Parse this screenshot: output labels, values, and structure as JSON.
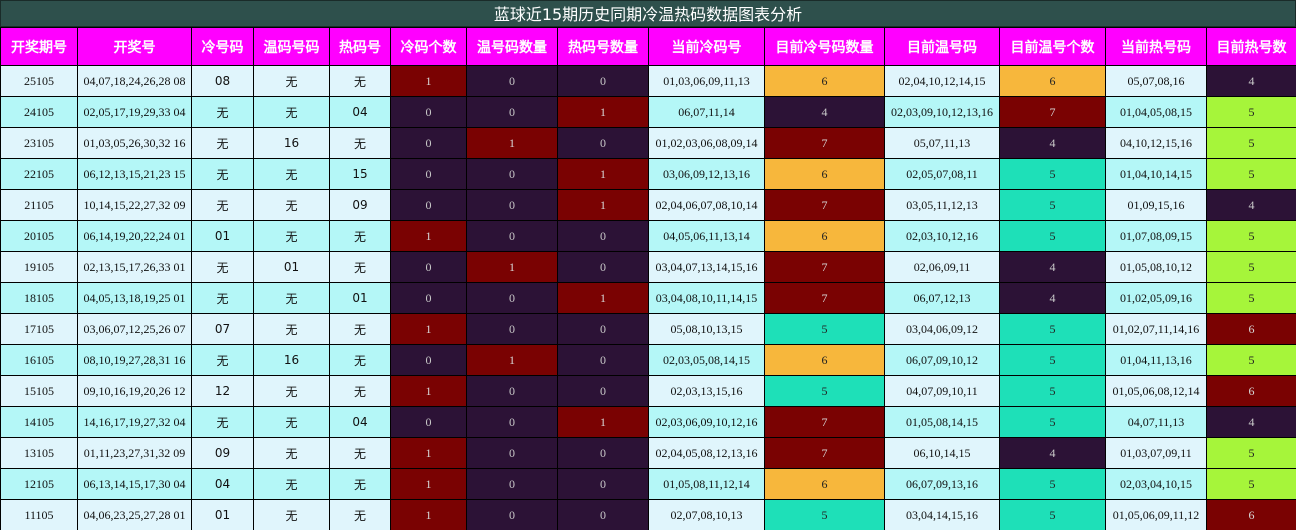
{
  "title": "蓝球近15期历史同期冷温热码数据图表分析",
  "colors": {
    "header_bg": "#ff00ff",
    "title_bg": "#2e504c",
    "count_dark": "#2c1236",
    "count_red": "#7a0202",
    "count_orange": "#f7b73c",
    "count_teal": "#1ee0b8",
    "count_green": "#a6f53a"
  },
  "headers": [
    "开奖期号",
    "开奖号",
    "冷号码",
    "温码号码",
    "热码号",
    "冷码个数",
    "温号码数量",
    "热码号数量",
    "当前冷码号",
    "目前冷号码数量",
    "目前温号码",
    "目前温号个数",
    "当前热号码",
    "目前热号数"
  ],
  "rows": [
    {
      "issue": "25105",
      "numbers": "04,07,18,24,26,28 08",
      "cold": "08",
      "warm": "无",
      "hot": "无",
      "cold_count": "1",
      "warm_count": "0",
      "hot_count": "0",
      "cur_cold": "01,03,06,09,11,13",
      "cur_cold_count": "6",
      "cur_warm": "02,04,10,12,14,15",
      "cur_warm_count": "6",
      "cur_hot": "05,07,08,16",
      "cur_hot_count": "4"
    },
    {
      "issue": "24105",
      "numbers": "02,05,17,19,29,33 04",
      "cold": "无",
      "warm": "无",
      "hot": "04",
      "cold_count": "0",
      "warm_count": "0",
      "hot_count": "1",
      "cur_cold": "06,07,11,14",
      "cur_cold_count": "4",
      "cur_warm": "02,03,09,10,12,13,16",
      "cur_warm_count": "7",
      "cur_hot": "01,04,05,08,15",
      "cur_hot_count": "5"
    },
    {
      "issue": "23105",
      "numbers": "01,03,05,26,30,32 16",
      "cold": "无",
      "warm": "16",
      "hot": "无",
      "cold_count": "0",
      "warm_count": "1",
      "hot_count": "0",
      "cur_cold": "01,02,03,06,08,09,14",
      "cur_cold_count": "7",
      "cur_warm": "05,07,11,13",
      "cur_warm_count": "4",
      "cur_hot": "04,10,12,15,16",
      "cur_hot_count": "5"
    },
    {
      "issue": "22105",
      "numbers": "06,12,13,15,21,23 15",
      "cold": "无",
      "warm": "无",
      "hot": "15",
      "cold_count": "0",
      "warm_count": "0",
      "hot_count": "1",
      "cur_cold": "03,06,09,12,13,16",
      "cur_cold_count": "6",
      "cur_warm": "02,05,07,08,11",
      "cur_warm_count": "5",
      "cur_hot": "01,04,10,14,15",
      "cur_hot_count": "5"
    },
    {
      "issue": "21105",
      "numbers": "10,14,15,22,27,32 09",
      "cold": "无",
      "warm": "无",
      "hot": "09",
      "cold_count": "0",
      "warm_count": "0",
      "hot_count": "1",
      "cur_cold": "02,04,06,07,08,10,14",
      "cur_cold_count": "7",
      "cur_warm": "03,05,11,12,13",
      "cur_warm_count": "5",
      "cur_hot": "01,09,15,16",
      "cur_hot_count": "4"
    },
    {
      "issue": "20105",
      "numbers": "06,14,19,20,22,24 01",
      "cold": "01",
      "warm": "无",
      "hot": "无",
      "cold_count": "1",
      "warm_count": "0",
      "hot_count": "0",
      "cur_cold": "04,05,06,11,13,14",
      "cur_cold_count": "6",
      "cur_warm": "02,03,10,12,16",
      "cur_warm_count": "5",
      "cur_hot": "01,07,08,09,15",
      "cur_hot_count": "5"
    },
    {
      "issue": "19105",
      "numbers": "02,13,15,17,26,33 01",
      "cold": "无",
      "warm": "01",
      "hot": "无",
      "cold_count": "0",
      "warm_count": "1",
      "hot_count": "0",
      "cur_cold": "03,04,07,13,14,15,16",
      "cur_cold_count": "7",
      "cur_warm": "02,06,09,11",
      "cur_warm_count": "4",
      "cur_hot": "01,05,08,10,12",
      "cur_hot_count": "5"
    },
    {
      "issue": "18105",
      "numbers": "04,05,13,18,19,25 01",
      "cold": "无",
      "warm": "无",
      "hot": "01",
      "cold_count": "0",
      "warm_count": "0",
      "hot_count": "1",
      "cur_cold": "03,04,08,10,11,14,15",
      "cur_cold_count": "7",
      "cur_warm": "06,07,12,13",
      "cur_warm_count": "4",
      "cur_hot": "01,02,05,09,16",
      "cur_hot_count": "5"
    },
    {
      "issue": "17105",
      "numbers": "03,06,07,12,25,26 07",
      "cold": "07",
      "warm": "无",
      "hot": "无",
      "cold_count": "1",
      "warm_count": "0",
      "hot_count": "0",
      "cur_cold": "05,08,10,13,15",
      "cur_cold_count": "5",
      "cur_warm": "03,04,06,09,12",
      "cur_warm_count": "5",
      "cur_hot": "01,02,07,11,14,16",
      "cur_hot_count": "6"
    },
    {
      "issue": "16105",
      "numbers": "08,10,19,27,28,31 16",
      "cold": "无",
      "warm": "16",
      "hot": "无",
      "cold_count": "0",
      "warm_count": "1",
      "hot_count": "0",
      "cur_cold": "02,03,05,08,14,15",
      "cur_cold_count": "6",
      "cur_warm": "06,07,09,10,12",
      "cur_warm_count": "5",
      "cur_hot": "01,04,11,13,16",
      "cur_hot_count": "5"
    },
    {
      "issue": "15105",
      "numbers": "09,10,16,19,20,26 12",
      "cold": "12",
      "warm": "无",
      "hot": "无",
      "cold_count": "1",
      "warm_count": "0",
      "hot_count": "0",
      "cur_cold": "02,03,13,15,16",
      "cur_cold_count": "5",
      "cur_warm": "04,07,09,10,11",
      "cur_warm_count": "5",
      "cur_hot": "01,05,06,08,12,14",
      "cur_hot_count": "6"
    },
    {
      "issue": "14105",
      "numbers": "14,16,17,19,27,32 04",
      "cold": "无",
      "warm": "无",
      "hot": "04",
      "cold_count": "0",
      "warm_count": "0",
      "hot_count": "1",
      "cur_cold": "02,03,06,09,10,12,16",
      "cur_cold_count": "7",
      "cur_warm": "01,05,08,14,15",
      "cur_warm_count": "5",
      "cur_hot": "04,07,11,13",
      "cur_hot_count": "4"
    },
    {
      "issue": "13105",
      "numbers": "01,11,23,27,31,32 09",
      "cold": "09",
      "warm": "无",
      "hot": "无",
      "cold_count": "1",
      "warm_count": "0",
      "hot_count": "0",
      "cur_cold": "02,04,05,08,12,13,16",
      "cur_cold_count": "7",
      "cur_warm": "06,10,14,15",
      "cur_warm_count": "4",
      "cur_hot": "01,03,07,09,11",
      "cur_hot_count": "5"
    },
    {
      "issue": "12105",
      "numbers": "06,13,14,15,17,30 04",
      "cold": "04",
      "warm": "无",
      "hot": "无",
      "cold_count": "1",
      "warm_count": "0",
      "hot_count": "0",
      "cur_cold": "01,05,08,11,12,14",
      "cur_cold_count": "6",
      "cur_warm": "06,07,09,13,16",
      "cur_warm_count": "5",
      "cur_hot": "02,03,04,10,15",
      "cur_hot_count": "5"
    },
    {
      "issue": "11105",
      "numbers": "04,06,23,25,27,28 01",
      "cold": "01",
      "warm": "无",
      "hot": "无",
      "cold_count": "1",
      "warm_count": "0",
      "hot_count": "0",
      "cur_cold": "02,07,08,10,13",
      "cur_cold_count": "5",
      "cur_warm": "03,04,14,15,16",
      "cur_warm_count": "5",
      "cur_hot": "01,05,06,09,11,12",
      "cur_hot_count": "6"
    }
  ]
}
